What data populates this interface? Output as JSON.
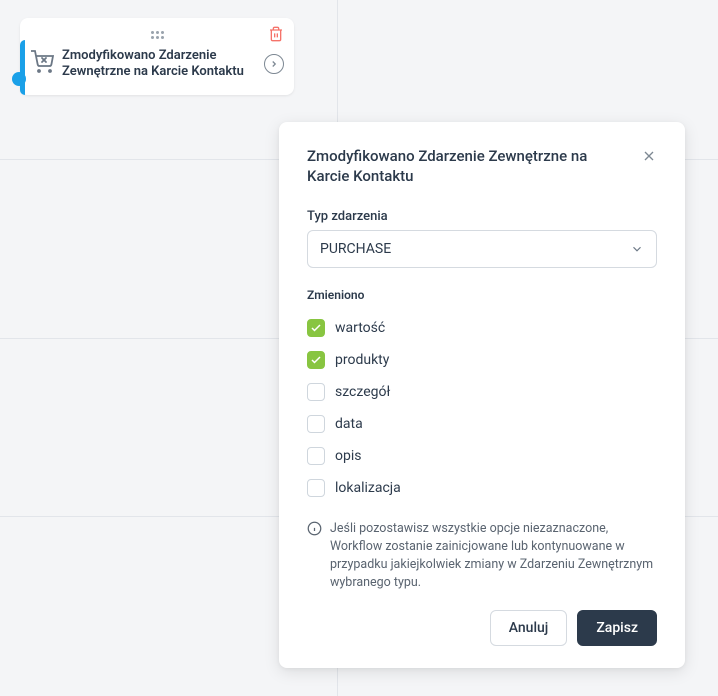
{
  "workflow_card": {
    "title": "Zmodyfikowano Zdarzenie Zewnętrzne na Karcie Kontaktu"
  },
  "panel": {
    "title": "Zmodyfikowano Zdarzenie Zewnętrzne na Karcie Kontaktu",
    "event_type_label": "Typ zdarzenia",
    "event_type_value": "PURCHASE",
    "changed_label": "Zmieniono",
    "options": [
      {
        "label": "wartość",
        "checked": true
      },
      {
        "label": "produkty",
        "checked": true
      },
      {
        "label": "szczegół",
        "checked": false
      },
      {
        "label": "data",
        "checked": false
      },
      {
        "label": "opis",
        "checked": false
      },
      {
        "label": "lokalizacja",
        "checked": false
      }
    ],
    "info_text": "Jeśli pozostawisz wszystkie opcje niezaznaczone, Workflow zostanie zainicjowane lub kontynuowane w przypadku jakiejkolwiek zmiany w Zdarzeniu Zewnętrznym wybranego typu.",
    "cancel_label": "Anuluj",
    "save_label": "Zapisz"
  }
}
